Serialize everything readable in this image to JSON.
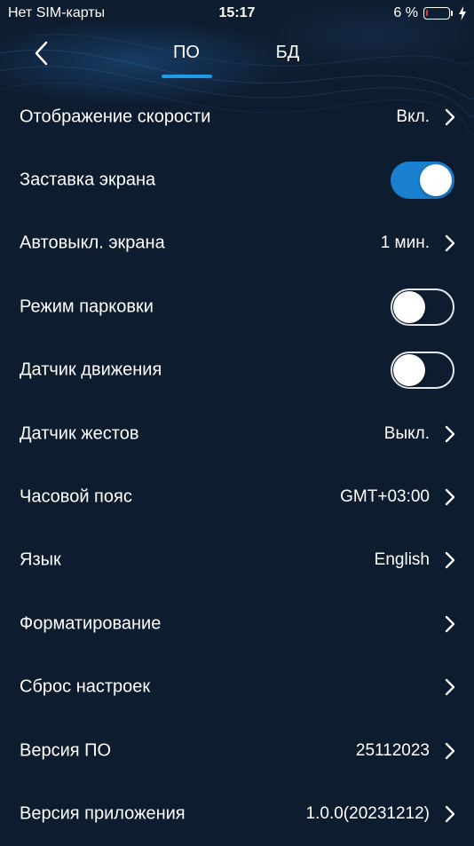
{
  "status_bar": {
    "carrier": "Нет SIM-карты",
    "time": "15:17",
    "battery_percent": "6 %",
    "battery_level": 0.06,
    "battery_color": "#e53935",
    "charging": true
  },
  "header": {
    "back_icon": "chevron-left-icon",
    "tabs": [
      {
        "label": "ПО",
        "active": true
      },
      {
        "label": "БД",
        "active": false
      }
    ],
    "accent_color": "#1e9be8"
  },
  "settings": [
    {
      "label": "Отображение скорости",
      "value": "Вкл.",
      "control": "chevron"
    },
    {
      "label": "Заставка экрана",
      "control": "toggle",
      "toggle_on": true
    },
    {
      "label": "Автовыкл. экрана",
      "value": "1 мин.",
      "control": "chevron"
    },
    {
      "label": "Режим парковки",
      "control": "toggle",
      "toggle_on": false
    },
    {
      "label": "Датчик движения",
      "control": "toggle",
      "toggle_on": false
    },
    {
      "label": "Датчик жестов",
      "value": "Выкл.",
      "control": "chevron"
    },
    {
      "label": "Часовой пояс",
      "value": "GMT+03:00",
      "control": "chevron"
    },
    {
      "label": "Язык",
      "value": "English",
      "control": "chevron"
    },
    {
      "label": "Форматирование",
      "value": "",
      "control": "chevron"
    },
    {
      "label": "Сброс настроек",
      "value": "",
      "control": "chevron"
    },
    {
      "label": "Версия ПО",
      "value": "25112023",
      "control": "chevron"
    },
    {
      "label": "Версия приложения",
      "value": "1.0.0(20231212)",
      "control": "chevron"
    }
  ],
  "colors": {
    "background": "#0e1c2f",
    "toggle_on": "#1b7fd0"
  }
}
